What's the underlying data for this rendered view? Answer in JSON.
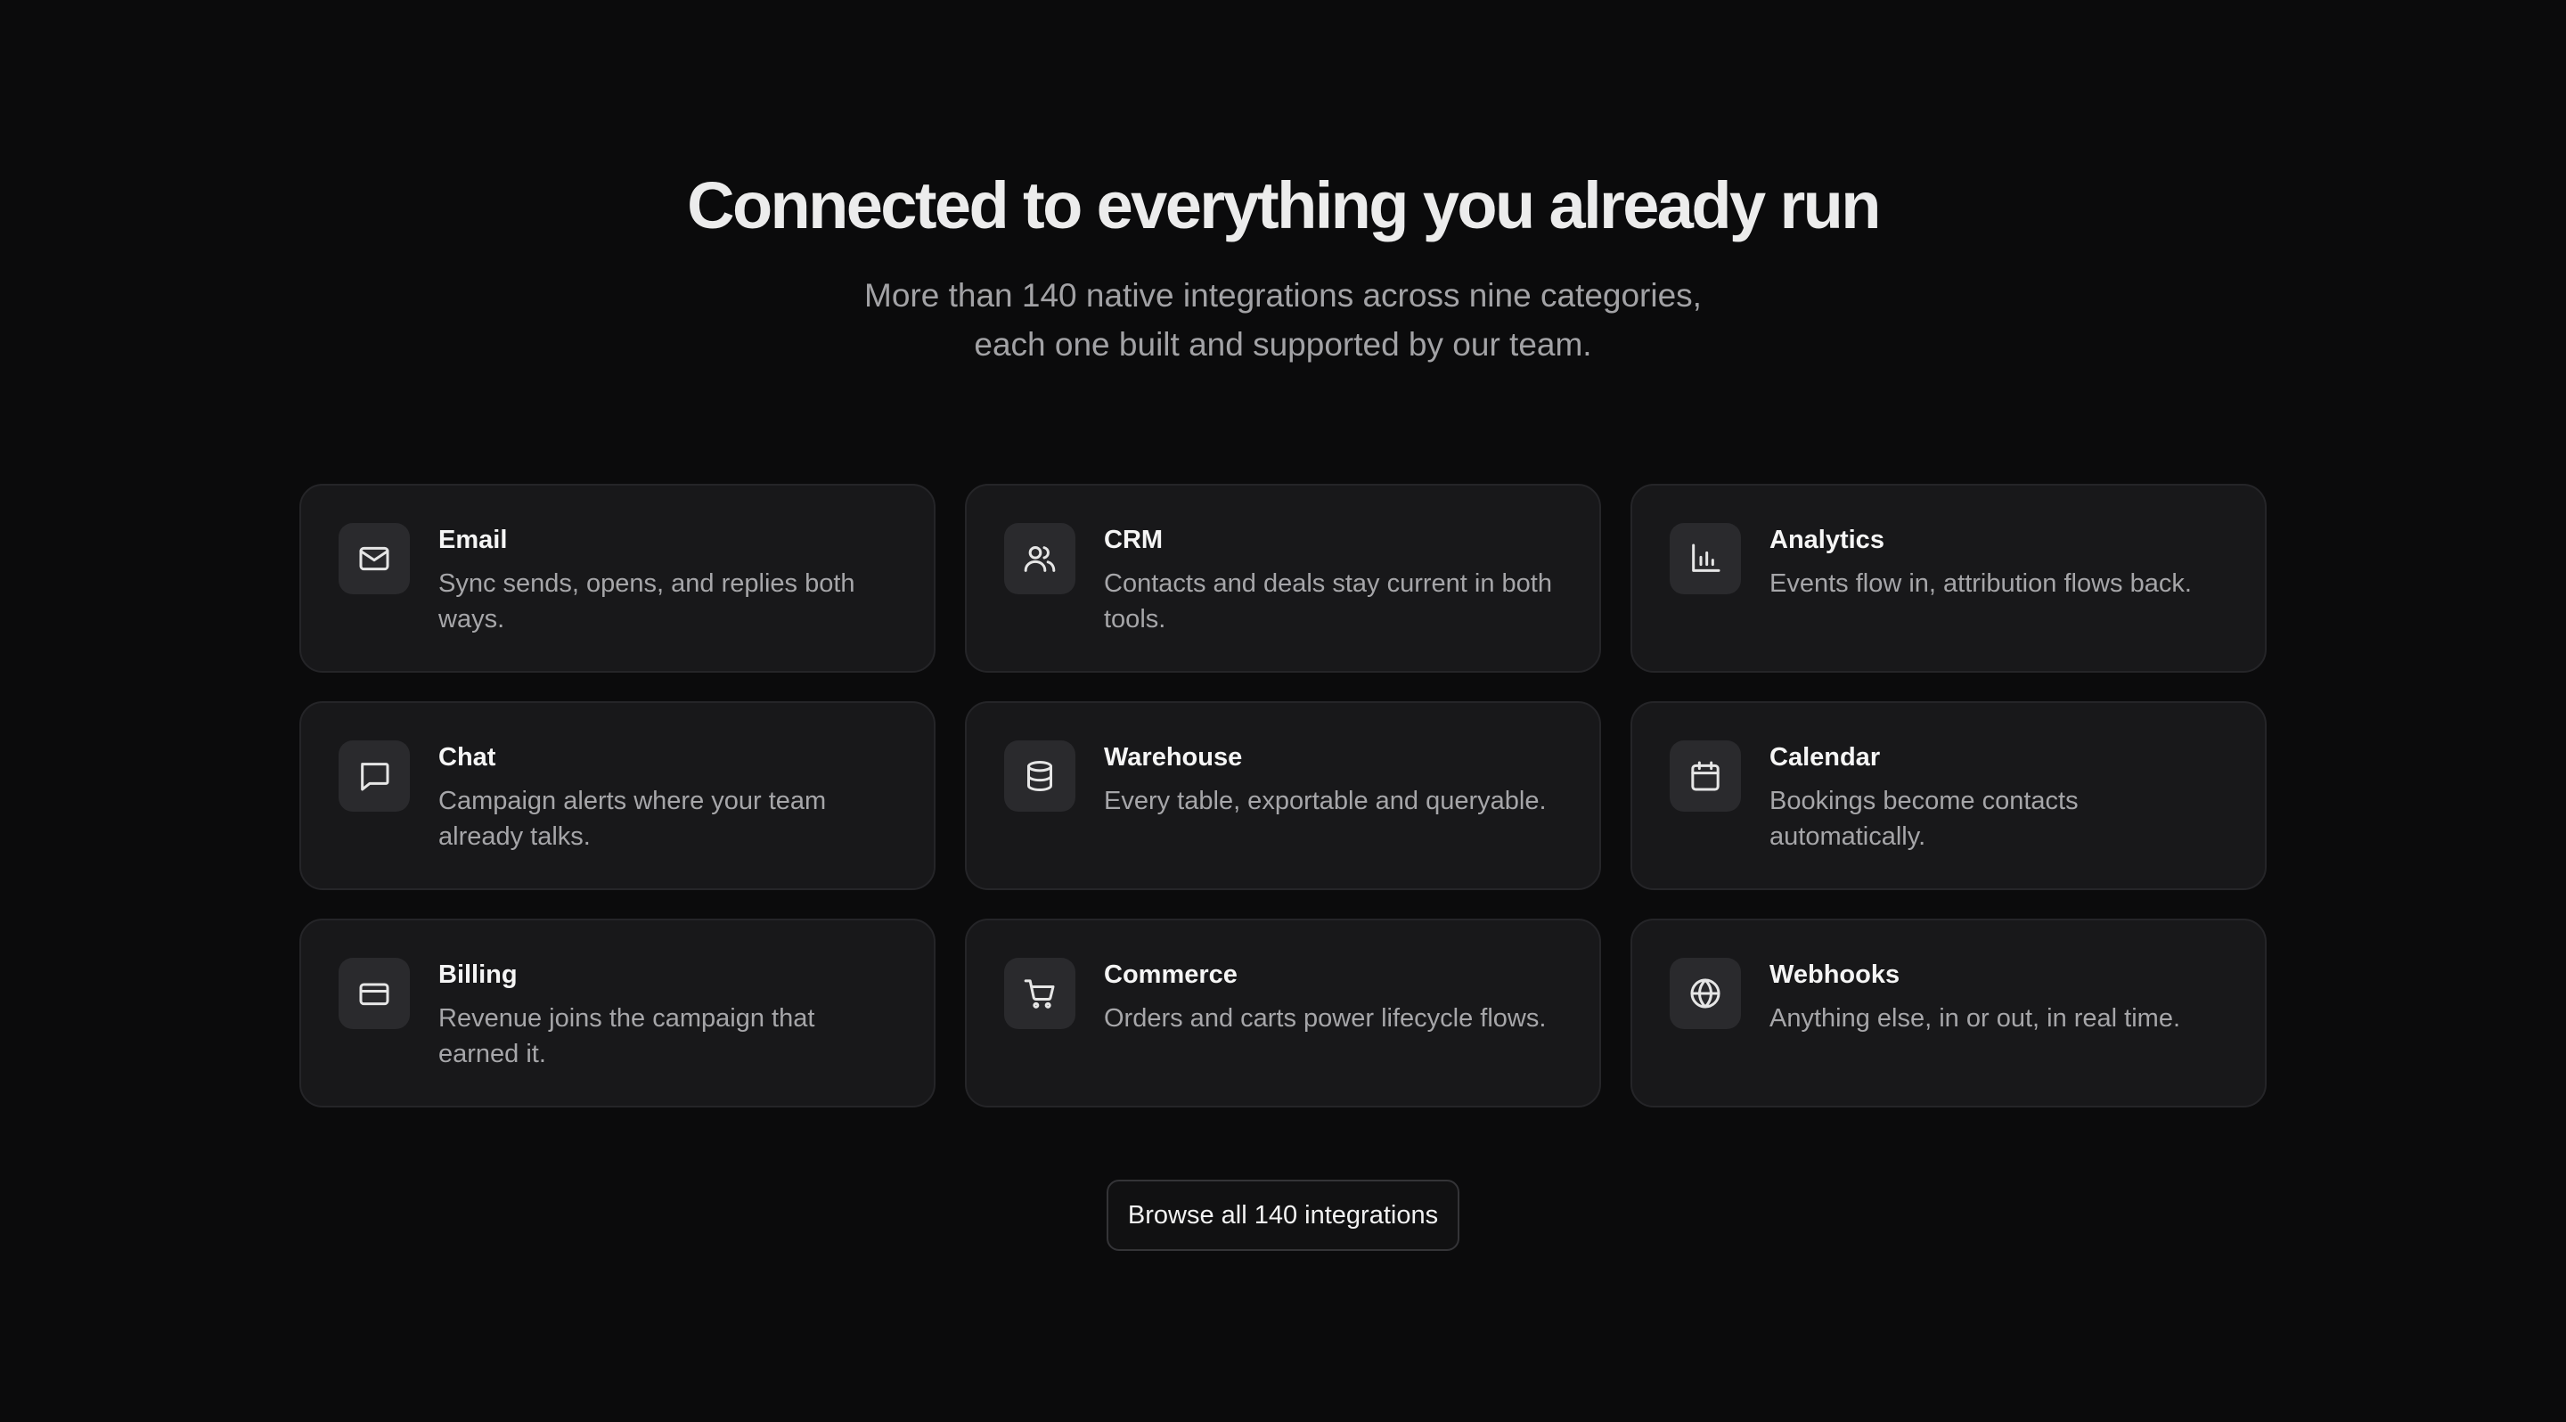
{
  "header": {
    "title": "Connected to everything you already run",
    "subtitle": "More than 140 native integrations across nine categories, each one built and supported by our team."
  },
  "integrations": [
    {
      "icon": "mail-icon",
      "title": "Email",
      "description": "Sync sends, opens, and replies both ways."
    },
    {
      "icon": "users-icon",
      "title": "CRM",
      "description": "Contacts and deals stay current in both tools."
    },
    {
      "icon": "bar-chart-icon",
      "title": "Analytics",
      "description": "Events flow in, attribution flows back."
    },
    {
      "icon": "chat-bubble-icon",
      "title": "Chat",
      "description": "Campaign alerts where your team already talks."
    },
    {
      "icon": "database-icon",
      "title": "Warehouse",
      "description": "Every table, exportable and queryable."
    },
    {
      "icon": "calendar-icon",
      "title": "Calendar",
      "description": "Bookings become contacts automatically."
    },
    {
      "icon": "credit-card-icon",
      "title": "Billing",
      "description": "Revenue joins the campaign that earned it."
    },
    {
      "icon": "shopping-cart-icon",
      "title": "Commerce",
      "description": "Orders and carts power lifecycle flows."
    },
    {
      "icon": "globe-icon",
      "title": "Webhooks",
      "description": "Anything else, in or out, in real time."
    }
  ],
  "cta": {
    "label": "Browse all 140 integrations"
  },
  "colors": {
    "background": "#0b0b0c",
    "card": "#18181a",
    "card_border": "#252528",
    "icon_tile": "#2a2a2d",
    "muted_text": "#a6a6a9"
  }
}
